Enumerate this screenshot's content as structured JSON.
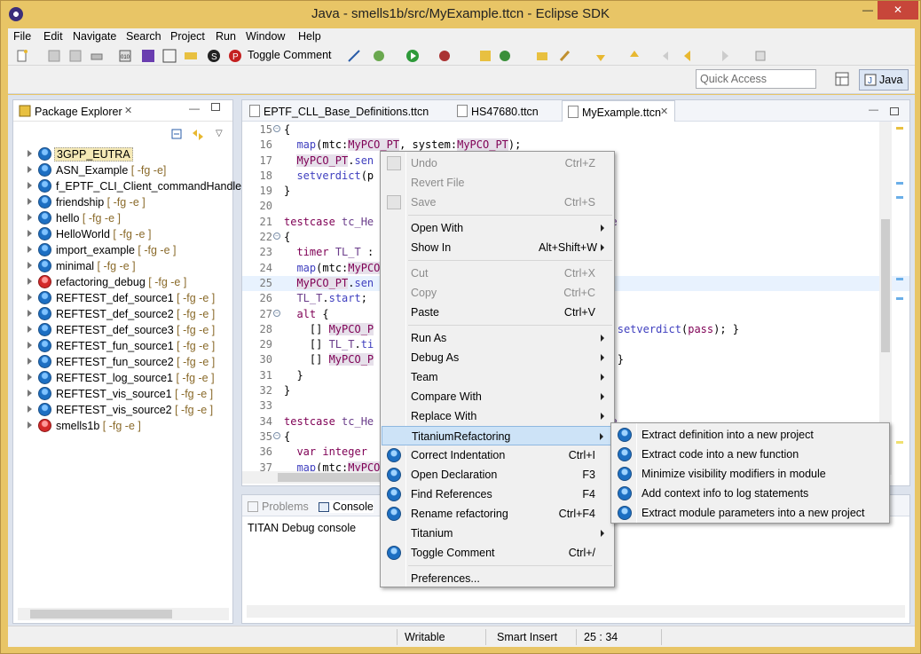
{
  "window": {
    "title": "Java - smells1b/src/MyExample.ttcn - Eclipse SDK",
    "minimize": "—",
    "maximize": "☐",
    "close": "✕"
  },
  "menu": [
    "File",
    "Edit",
    "Navigate",
    "Search",
    "Project",
    "Run",
    "Window",
    "Help"
  ],
  "toolbar": {
    "toggle_comment": "Toggle Comment"
  },
  "quick_access": {
    "placeholder": "Quick Access"
  },
  "perspective": {
    "label": "Java"
  },
  "package_explorer": {
    "title": "Package Explorer",
    "projects": [
      {
        "name": "3GPP_EUTRA",
        "decoration": "",
        "selected": true,
        "icon": "titan-project-icon"
      },
      {
        "name": "ASN_Example",
        "decoration": " [ -fg -e]",
        "icon": "titan-project-icon"
      },
      {
        "name": "f_EPTF_CLI_Client_commandHandle",
        "decoration": "",
        "icon": "titan-project-icon"
      },
      {
        "name": "friendship",
        "decoration": " [ -fg -e ]",
        "icon": "titan-project-icon"
      },
      {
        "name": "hello",
        "decoration": " [ -fg -e ]",
        "icon": "titan-project-icon"
      },
      {
        "name": "HelloWorld",
        "decoration": " [ -fg -e ]",
        "icon": "titan-project-icon"
      },
      {
        "name": "import_example",
        "decoration": " [ -fg -e ]",
        "icon": "titan-project-icon"
      },
      {
        "name": "minimal",
        "decoration": " [ -fg -e ]",
        "icon": "titan-project-icon"
      },
      {
        "name": "refactoring_debug",
        "decoration": " [ -fg -e ]",
        "icon": "error-project-icon"
      },
      {
        "name": "REFTEST_def_source1",
        "decoration": " [ -fg -e ]",
        "icon": "titan-project-icon"
      },
      {
        "name": "REFTEST_def_source2",
        "decoration": " [ -fg -e ]",
        "icon": "titan-project-icon"
      },
      {
        "name": "REFTEST_def_source3",
        "decoration": " [ -fg -e ]",
        "icon": "titan-project-icon"
      },
      {
        "name": "REFTEST_fun_source1",
        "decoration": " [ -fg -e ]",
        "icon": "titan-project-icon"
      },
      {
        "name": "REFTEST_fun_source2",
        "decoration": " [ -fg -e ]",
        "icon": "titan-project-icon"
      },
      {
        "name": "REFTEST_log_source1",
        "decoration": " [ -fg -e ]",
        "icon": "titan-project-icon"
      },
      {
        "name": "REFTEST_vis_source1",
        "decoration": " [ -fg -e ]",
        "icon": "titan-project-icon"
      },
      {
        "name": "REFTEST_vis_source2",
        "decoration": " [ -fg -e ]",
        "icon": "titan-project-icon"
      },
      {
        "name": "smells1b",
        "decoration": " [ -fg -e ]",
        "icon": "error-project-icon"
      }
    ]
  },
  "editor": {
    "tabs": [
      {
        "label": "EPTF_CLL_Base_Definitions.ttcn",
        "active": false
      },
      {
        "label": "HS47680.ttcn",
        "active": false
      },
      {
        "label": "MyExample.ttcn",
        "active": true
      }
    ],
    "lines": [
      {
        "n": "15",
        "fold": "−",
        "html": "{"
      },
      {
        "n": "16",
        "fold": "",
        "html": "  <span class=\"fn\">map</span>(mtc:<span class=\"hv\">MyPCO_PT</span>, system:<span class=\"hv\">MyPCO_PT</span>);"
      },
      {
        "n": "17",
        "fold": "",
        "html": "  <span class=\"hv\">MyPCO_PT</span>.<span class=\"fn\">sen</span>"
      },
      {
        "n": "18",
        "fold": "",
        "html": "  <span class=\"fn\">setverdict</span>(p"
      },
      {
        "n": "19",
        "fold": "",
        "html": "}"
      },
      {
        "n": "20",
        "fold": "",
        "html": ""
      },
      {
        "n": "21",
        "fold": "",
        "html": "<span class=\"kw\">testcase</span> <span class=\"id\">tc_He</span>                                 <span class=\"id\">CType</span>"
      },
      {
        "n": "22",
        "fold": "−",
        "html": "{"
      },
      {
        "n": "23",
        "fold": "",
        "html": "  <span class=\"kw\">timer</span> <span class=\"id\">TL_T</span> :"
      },
      {
        "n": "24",
        "fold": "",
        "html": "  <span class=\"fn\">map</span>(mtc:<span class=\"hv\">MyPCO</span>"
      },
      {
        "n": "25",
        "fold": "",
        "html": "  <span class=\"hv\">MyPCO_PT</span>.<span class=\"fn\">sen</span>",
        "highlight": true
      },
      {
        "n": "26",
        "fold": "",
        "html": "  <span class=\"id\">TL_T</span>.<span class=\"fn\">start</span>;"
      },
      {
        "n": "27",
        "fold": "−",
        "html": "  <span class=\"kw\">alt</span> {"
      },
      {
        "n": "28",
        "fold": "",
        "html": "    [] <span class=\"hv\">MyPCO_P</span>                              <span class=\"id\">T</span>.<span class=\"fn\">stop</span>; <span class=\"fn\">setverdict</span>(<span class=\"kw\">pass</span>); }"
      },
      {
        "n": "29",
        "fold": "",
        "html": "    [] <span class=\"id\">TL_T</span>.<span class=\"fn\">ti</span>"
      },
      {
        "n": "30",
        "fold": "",
        "html": "    [] <span class=\"hv\">MyPCO_P</span>                              (<span class=\"kw\">fail</span>); }"
      },
      {
        "n": "31",
        "fold": "",
        "html": "  }"
      },
      {
        "n": "32",
        "fold": "",
        "html": "}"
      },
      {
        "n": "33",
        "fold": "",
        "html": ""
      },
      {
        "n": "34",
        "fold": "",
        "html": "<span class=\"kw\">testcase</span> <span class=\"id\">tc_He</span>                                 <span class=\"id\">CType</span>"
      },
      {
        "n": "35",
        "fold": "−",
        "html": "{"
      },
      {
        "n": "36",
        "fold": "",
        "html": "  <span class=\"kw\">var</span> <span class=\"kw\">integer</span>"
      },
      {
        "n": "37",
        "fold": "",
        "html": "  <span class=\"fn\">map</span>(mtc:<span class=\"hv\">MyPCO</span>"
      }
    ]
  },
  "bottom_panel": {
    "tabs": [
      "Problems",
      "Console"
    ],
    "console_title": "TITAN Debug console"
  },
  "status": {
    "writable": "Writable",
    "insert": "Smart Insert",
    "position": "25 : 34"
  },
  "context_menu": {
    "items": [
      {
        "label": "Undo",
        "shortcut": "Ctrl+Z",
        "disabled": true,
        "icon": "undo-icon"
      },
      {
        "label": "Revert File",
        "shortcut": "",
        "disabled": true
      },
      {
        "label": "Save",
        "shortcut": "Ctrl+S",
        "disabled": true,
        "icon": "save-icon"
      },
      {
        "sep": true
      },
      {
        "label": "Open With",
        "shortcut": "",
        "submenu": true
      },
      {
        "label": "Show In",
        "shortcut": "Alt+Shift+W",
        "submenu": true
      },
      {
        "sep": true
      },
      {
        "label": "Cut",
        "shortcut": "Ctrl+X",
        "disabled": true
      },
      {
        "label": "Copy",
        "shortcut": "Ctrl+C",
        "disabled": true
      },
      {
        "label": "Paste",
        "shortcut": "Ctrl+V"
      },
      {
        "sep": true
      },
      {
        "label": "Run As",
        "shortcut": "",
        "submenu": true
      },
      {
        "label": "Debug As",
        "shortcut": "",
        "submenu": true
      },
      {
        "label": "Team",
        "shortcut": "",
        "submenu": true
      },
      {
        "label": "Compare With",
        "shortcut": "",
        "submenu": true
      },
      {
        "label": "Replace With",
        "shortcut": "",
        "submenu": true
      },
      {
        "label": "TitaniumRefactoring",
        "shortcut": "",
        "submenu": true,
        "selected": true
      },
      {
        "label": "Correct Indentation",
        "shortcut": "Ctrl+I",
        "icon": "titan-icon"
      },
      {
        "label": "Open Declaration",
        "shortcut": "F3",
        "icon": "titan-icon"
      },
      {
        "label": "Find References",
        "shortcut": "F4",
        "icon": "titan-icon"
      },
      {
        "label": "Rename refactoring",
        "shortcut": "Ctrl+F4",
        "icon": "titan-icon"
      },
      {
        "label": "Titanium",
        "shortcut": "",
        "submenu": true
      },
      {
        "label": "Toggle Comment",
        "shortcut": "Ctrl+/",
        "icon": "titan-icon"
      },
      {
        "sep": true
      },
      {
        "label": "Preferences...",
        "shortcut": ""
      }
    ]
  },
  "submenu": {
    "items": [
      "Extract definition into a new project",
      "Extract code into a new function",
      "Minimize visibility modifiers in module",
      "Add context info to log statements",
      "Extract module parameters into a new project"
    ]
  }
}
